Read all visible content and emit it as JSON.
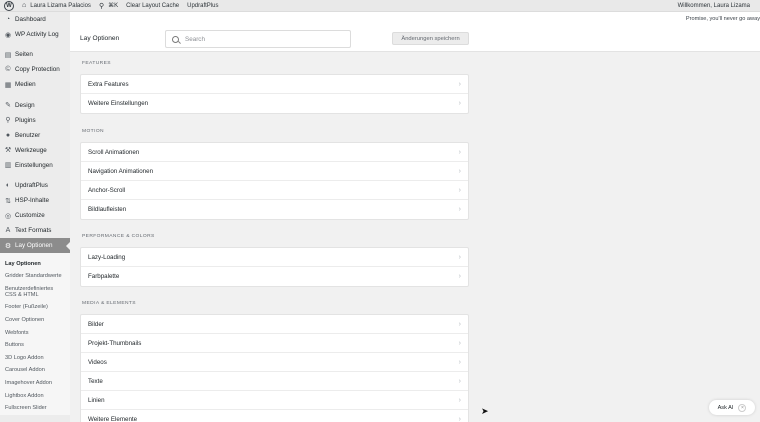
{
  "adminbar": {
    "site_name": "Laura Lizama Palacios",
    "shortcut": "⌘K",
    "cache": "Clear Layout Cache",
    "updraft": "UpdraftPlus",
    "greeting": "Willkommen, Laura Lizama"
  },
  "notice": {
    "text": "Promise, you'll never go away"
  },
  "sidebar": {
    "items": [
      {
        "label": "Dashboard",
        "icon": "dashboard-icon",
        "glyph": "◔"
      },
      {
        "label": "WP Activity Log",
        "icon": "activity-log-icon",
        "glyph": "◉"
      },
      {
        "label": "Seiten",
        "icon": "pages-icon",
        "glyph": "▤"
      },
      {
        "label": "Copy Protection",
        "icon": "copy-protection-icon",
        "glyph": "©"
      },
      {
        "label": "Medien",
        "icon": "media-icon",
        "glyph": "▦"
      },
      {
        "label": "Design",
        "icon": "brush-icon",
        "glyph": "✎"
      },
      {
        "label": "Plugins",
        "icon": "plugin-icon",
        "glyph": "⚲"
      },
      {
        "label": "Benutzer",
        "icon": "users-icon",
        "glyph": "●"
      },
      {
        "label": "Werkzeuge",
        "icon": "wrench-icon",
        "glyph": "⚒"
      },
      {
        "label": "Einstellungen",
        "icon": "settings-icon",
        "glyph": "▥"
      },
      {
        "label": "UpdraftPlus",
        "icon": "updraft-icon",
        "glyph": "◐"
      },
      {
        "label": "HSP-Inhalte",
        "icon": "hsp-icon",
        "glyph": "⇅"
      },
      {
        "label": "Customize",
        "icon": "eye-icon",
        "glyph": "◎"
      },
      {
        "label": "Text Formats",
        "icon": "text-format-icon",
        "glyph": "A"
      },
      {
        "label": "Lay Optionen",
        "icon": "gear-icon",
        "glyph": "⚙"
      }
    ],
    "submenu": [
      "Lay Optionen",
      "Gridder Standardwerte",
      "Benutzerdefiniertes CSS & HTML",
      "Footer (Fußzeile)",
      "Cover Optionen",
      "Webfonts",
      "Buttons",
      "3D Logo Addon",
      "Carousel Addon",
      "Imagehover Addon",
      "Lightbox Addon",
      "Fullscreen Slider"
    ]
  },
  "header": {
    "title": "Lay Optionen",
    "search_placeholder": "Search",
    "save_label": "Änderungen speichern"
  },
  "sections": [
    {
      "title": "FEATURES",
      "items": [
        "Extra Features",
        "Weitere Einstellungen"
      ]
    },
    {
      "title": "MOTION",
      "items": [
        "Scroll Animationen",
        "Navigation Animationen",
        "Anchor-Scroll",
        "Bildlaufleisten"
      ]
    },
    {
      "title": "PERFORMANCE & COLORS",
      "items": [
        "Lazy-Loading",
        "Farbpalette"
      ]
    },
    {
      "title": "MEDIA & ELEMENTS",
      "items": [
        "Bilder",
        "Projekt-Thumbnails",
        "Videos",
        "Texte",
        "Linien",
        "Weitere Elemente"
      ]
    }
  ],
  "ask_ai": {
    "label": "Ask AI",
    "close": "×"
  },
  "icons": {
    "chevron": "›",
    "wordpress": "W",
    "search": "⚲"
  }
}
